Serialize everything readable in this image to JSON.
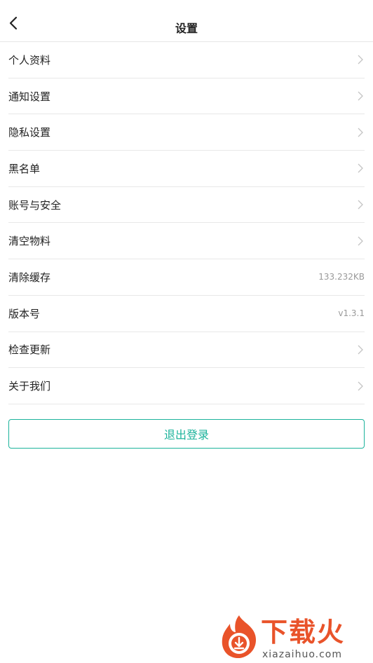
{
  "header": {
    "title": "设置",
    "back_icon": "chevron-left-icon"
  },
  "settings": {
    "items": [
      {
        "label": "个人资料",
        "value": "",
        "icon": "chevron-right-icon"
      },
      {
        "label": "通知设置",
        "value": "",
        "icon": "chevron-right-icon"
      },
      {
        "label": "隐私设置",
        "value": "",
        "icon": "chevron-right-icon"
      },
      {
        "label": "黑名单",
        "value": "",
        "icon": "chevron-right-icon"
      },
      {
        "label": "账号与安全",
        "value": "",
        "icon": "chevron-right-icon"
      },
      {
        "label": "清空物料",
        "value": "",
        "icon": "chevron-right-icon"
      },
      {
        "label": "清除缓存",
        "value": "133.232KB",
        "icon": ""
      },
      {
        "label": "版本号",
        "value": "v1.3.1",
        "icon": ""
      },
      {
        "label": "检查更新",
        "value": "",
        "icon": "chevron-right-icon"
      },
      {
        "label": "关于我们",
        "value": "",
        "icon": "chevron-right-icon"
      }
    ]
  },
  "logout": {
    "label": "退出登录"
  },
  "watermark": {
    "name": "下载火",
    "url": "xiazaihuo.com"
  },
  "colors": {
    "accent": "#1bb39b",
    "watermark": "#e9532a"
  }
}
